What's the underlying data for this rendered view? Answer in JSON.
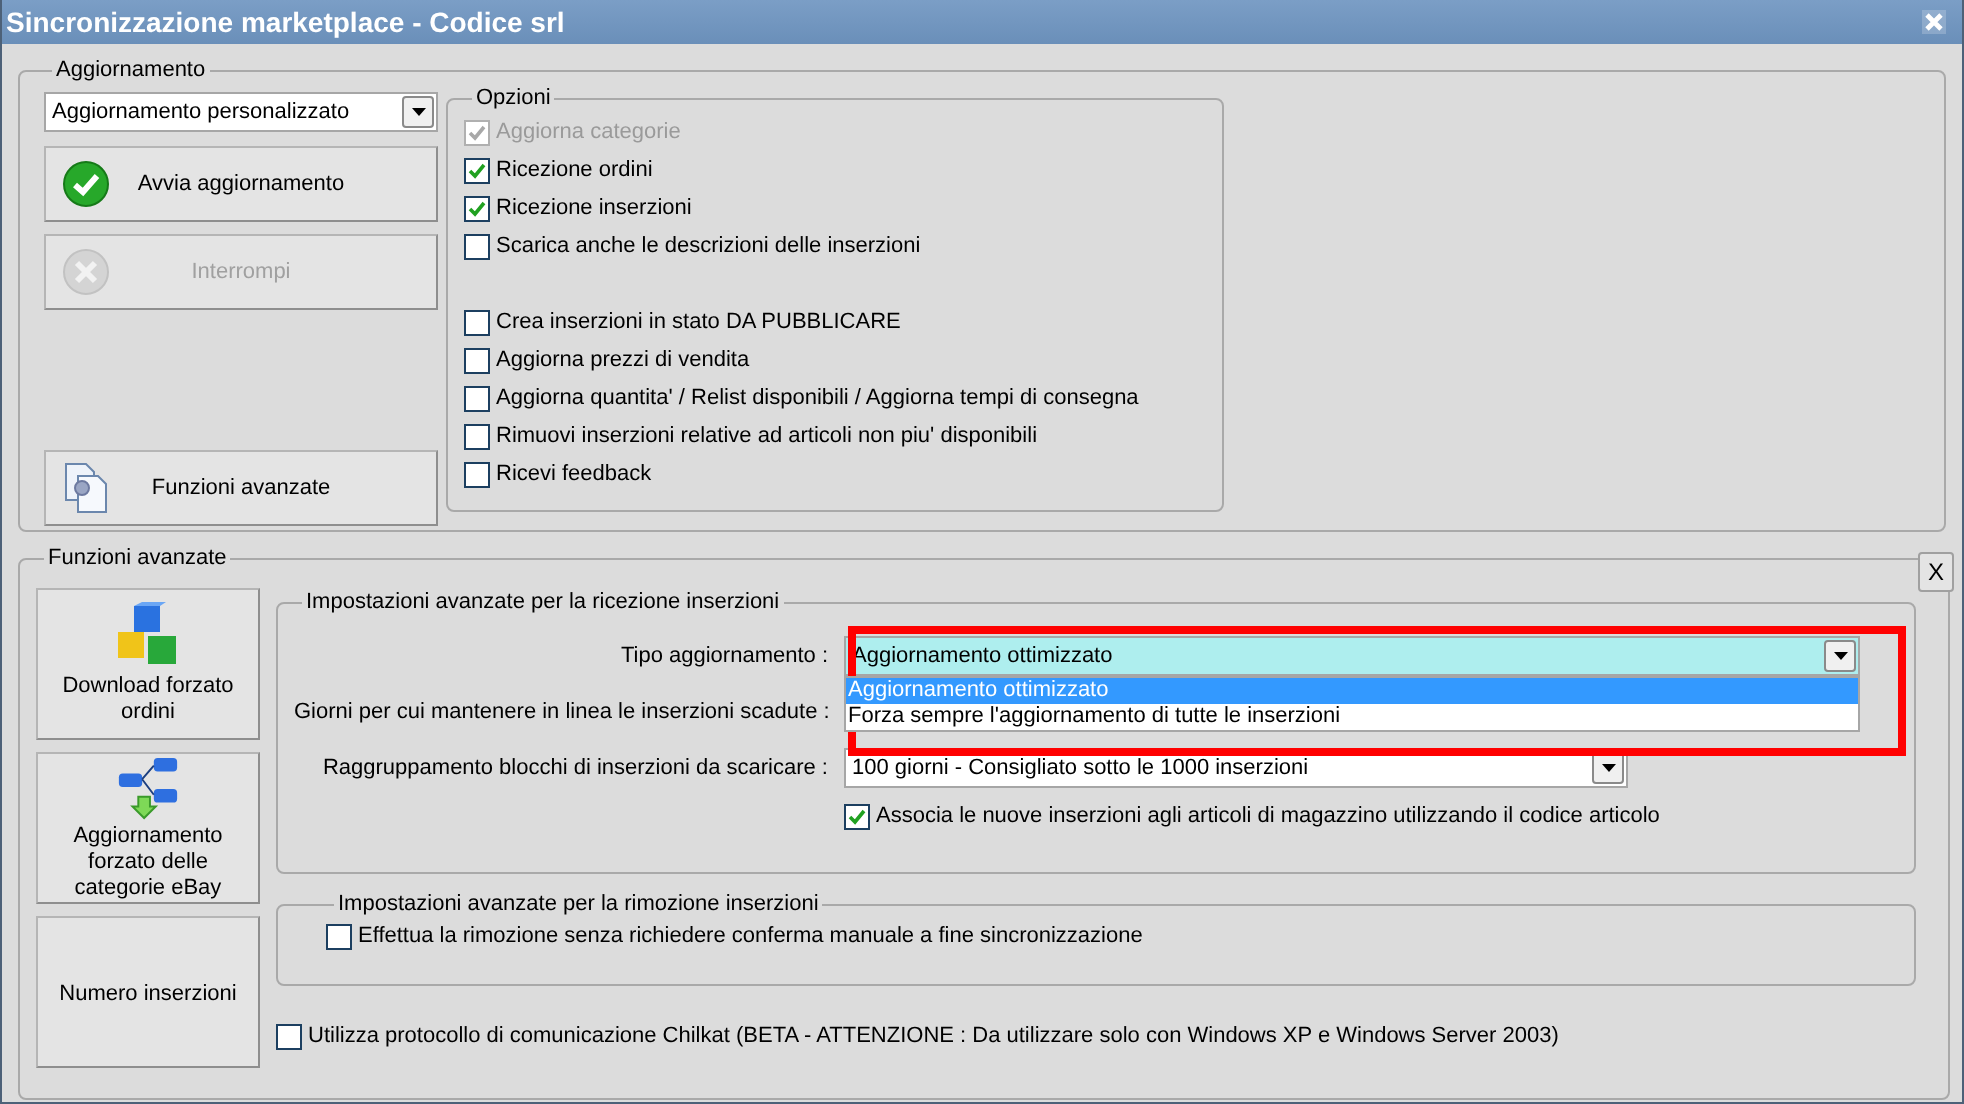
{
  "window": {
    "title": "Sincronizzazione marketplace - Codice srl"
  },
  "aggiornamento": {
    "legend": "Aggiornamento",
    "mode": {
      "value": "Aggiornamento personalizzato"
    },
    "buttons": [
      {
        "label": "Avvia aggiornamento",
        "kind": "start",
        "disabled": false
      },
      {
        "label": "Interrompi",
        "kind": "stop",
        "disabled": true
      },
      {
        "label": "Funzioni avanzate",
        "kind": "advanced",
        "disabled": false
      }
    ],
    "opzioni": {
      "legend": "Opzioni",
      "groups": [
        {
          "items": [
            {
              "label": "Aggiorna categorie",
              "checked": true,
              "disabled": true
            },
            {
              "label": "Ricezione ordini",
              "checked": true,
              "disabled": false
            },
            {
              "label": "Ricezione inserzioni",
              "checked": true,
              "disabled": false
            },
            {
              "label": "Scarica anche le descrizioni delle inserzioni",
              "checked": false,
              "disabled": false
            }
          ]
        },
        {
          "items": [
            {
              "label": "Crea inserzioni in stato DA PUBBLICARE",
              "checked": false,
              "disabled": false
            },
            {
              "label": "Aggiorna prezzi di vendita",
              "checked": false,
              "disabled": false
            },
            {
              "label": "Aggiorna quantita' / Relist disponibili / Aggiorna tempi di consegna",
              "checked": false,
              "disabled": false
            },
            {
              "label": "Rimuovi inserzioni relative ad articoli non piu' disponibili",
              "checked": false,
              "disabled": false
            },
            {
              "label": "Ricevi feedback",
              "checked": false,
              "disabled": false
            }
          ]
        }
      ]
    }
  },
  "funzioni_avanzate": {
    "legend": "Funzioni avanzate",
    "close_label": "X",
    "buttons": [
      {
        "label": "Download forzato ordini",
        "kind": "download"
      },
      {
        "label": "Aggiornamento forzato delle categorie eBay",
        "kind": "categories"
      },
      {
        "label": "Numero inserzioni",
        "kind": "count"
      }
    ],
    "ricezione": {
      "legend": "Impostazioni avanzate per la ricezione inserzioni",
      "fields": [
        {
          "label": "Tipo aggiornamento :",
          "value": "Aggiornamento ottimizzato",
          "expanded": true,
          "options": [
            {
              "label": "Aggiornamento ottimizzato",
              "selected": true
            },
            {
              "label": "Forza sempre l'aggiornamento di tutte le inserzioni",
              "selected": false
            }
          ]
        },
        {
          "label": "Giorni per cui mantenere in linea le inserzioni scadute :"
        },
        {
          "label": "Raggruppamento blocchi di inserzioni da scaricare :",
          "value": "100 giorni - Consigliato sotto le 1000 inserzioni",
          "expanded": false
        }
      ],
      "associa": {
        "label": "Associa le nuove inserzioni agli articoli di magazzino utilizzando il codice articolo",
        "checked": true
      }
    },
    "rimozione": {
      "legend": "Impostazioni avanzate per la rimozione inserzioni",
      "option": {
        "label": "Effettua la rimozione senza richiedere conferma manuale a fine sincronizzazione",
        "checked": false
      }
    },
    "chilkat": {
      "label": "Utilizza protocollo di comunicazione Chilkat (BETA - ATTENZIONE : Da utilizzare solo con Windows XP e Windows Server 2003)",
      "checked": false
    }
  }
}
